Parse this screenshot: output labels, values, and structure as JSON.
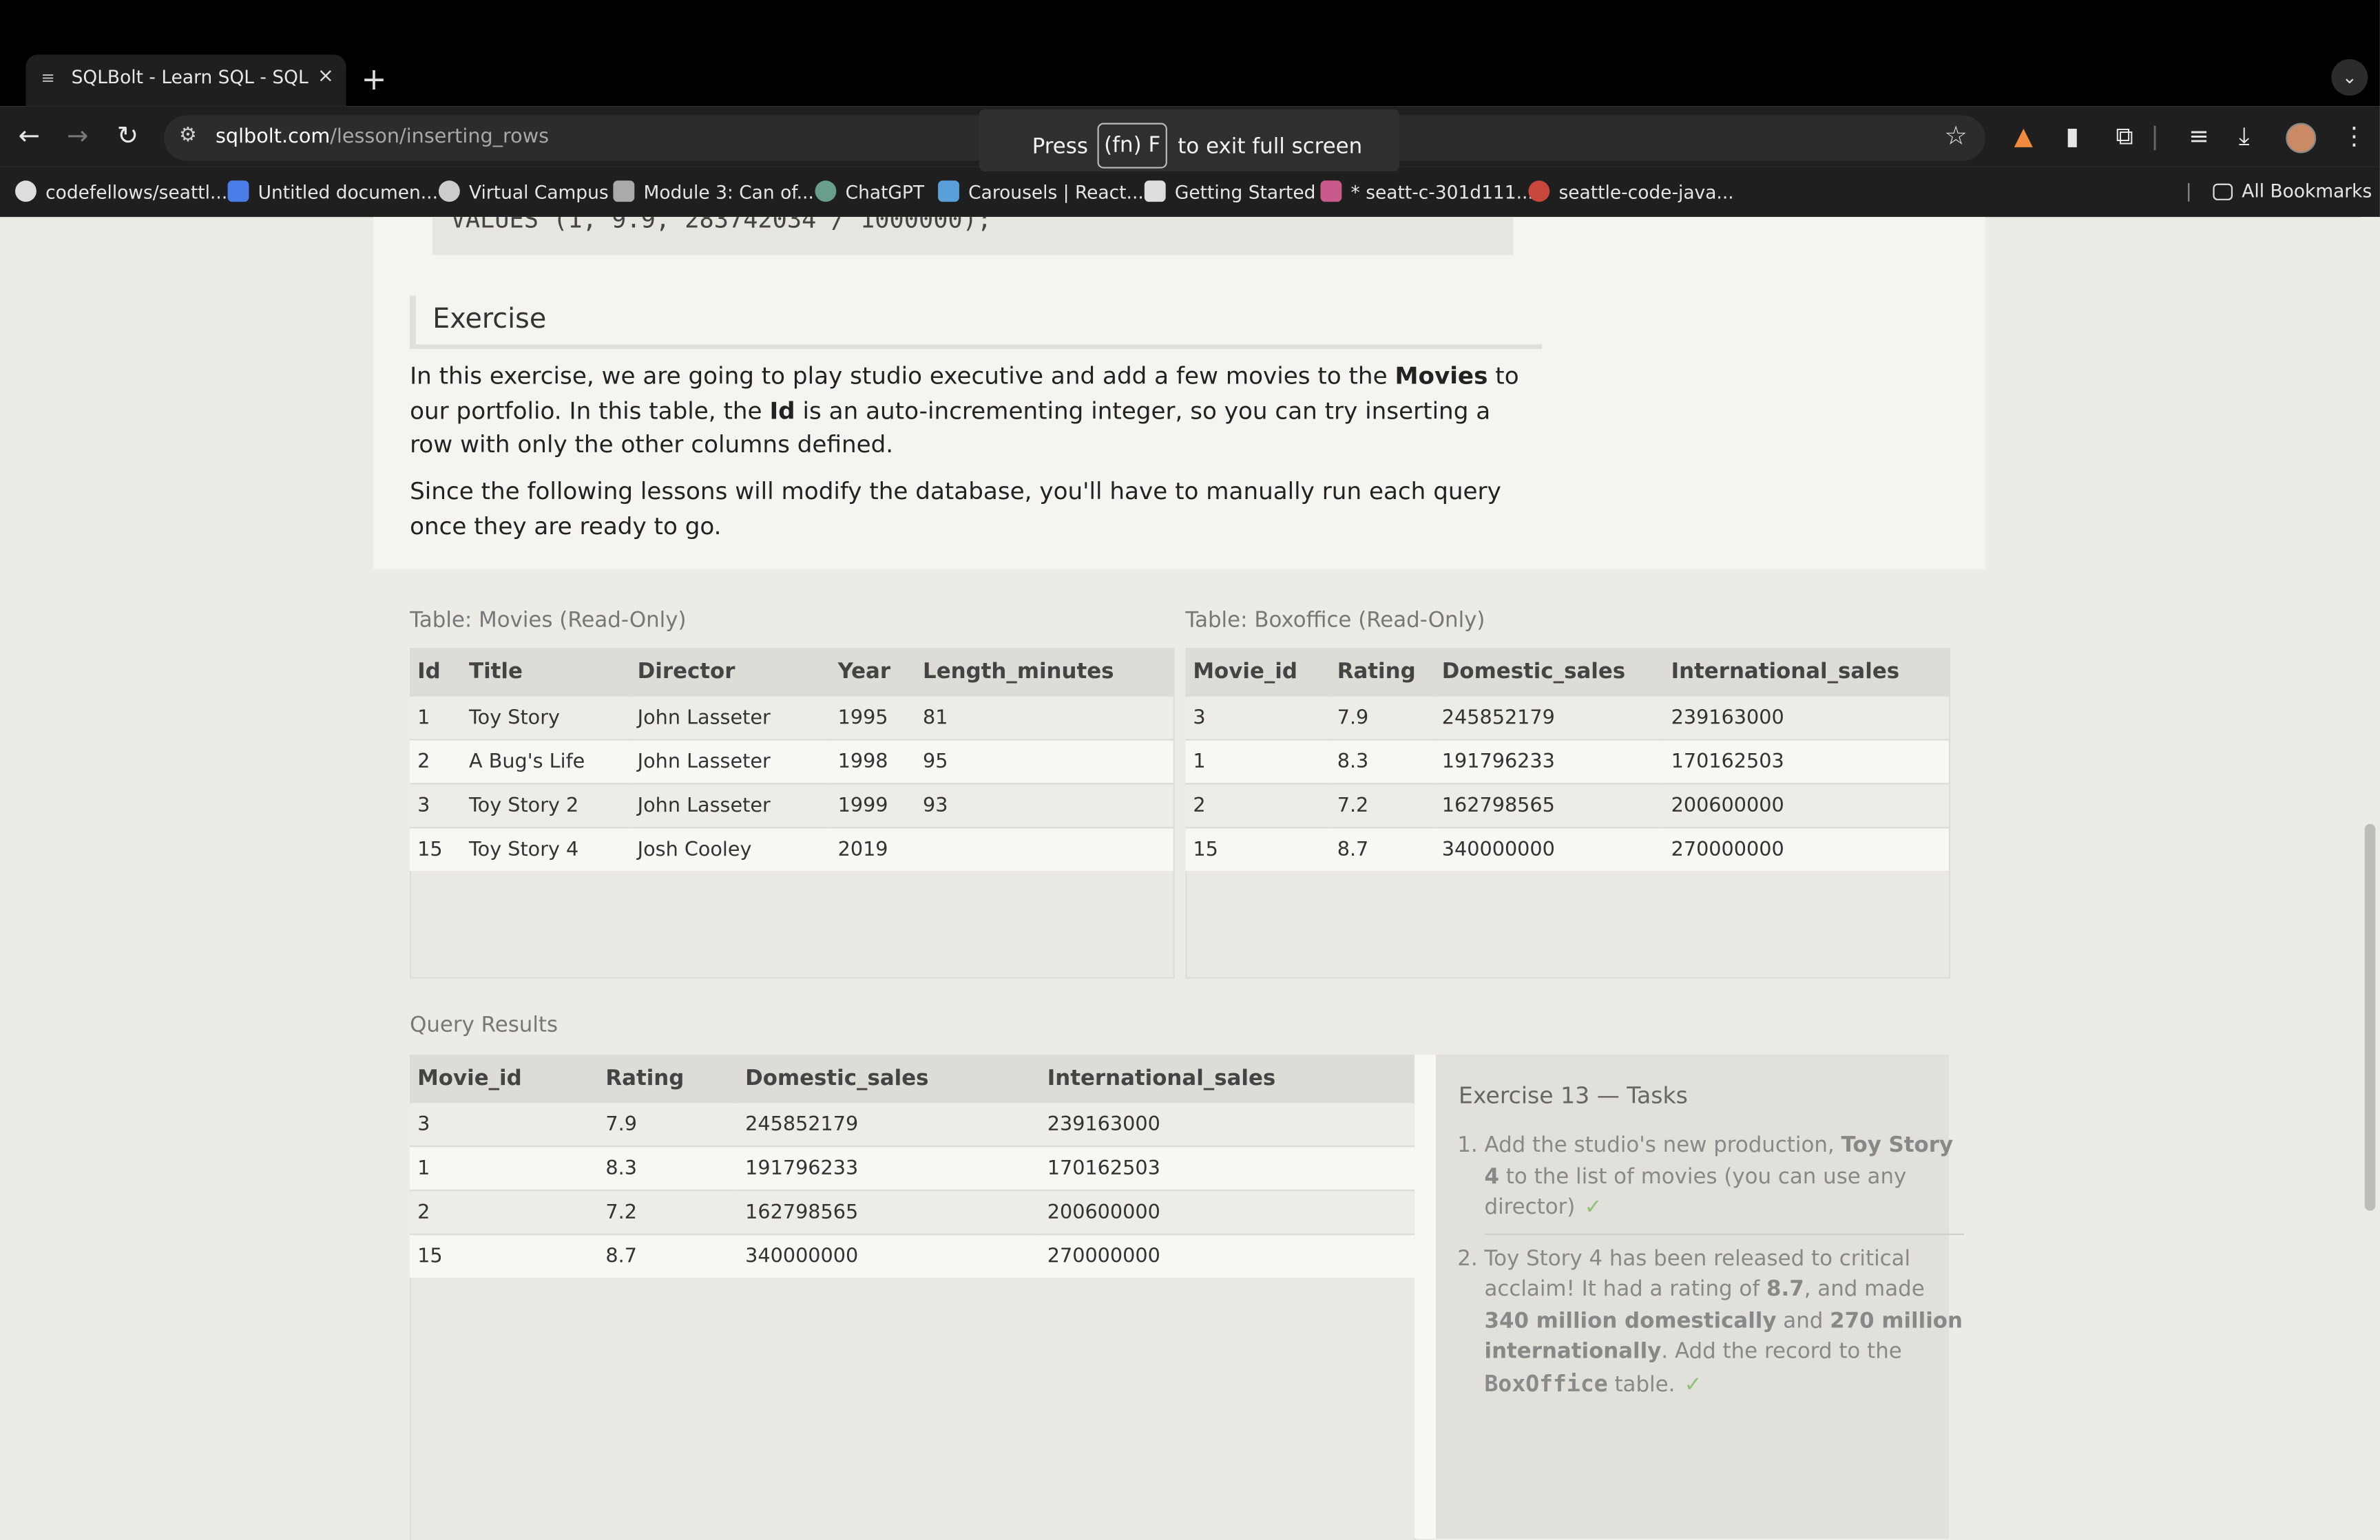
{
  "browser": {
    "tab_title": "SQLBolt - Learn SQL - SQL L",
    "tab_close": "×",
    "new_tab": "+",
    "url_host": "sqlbolt.com",
    "url_path": "/lesson/inserting_rows",
    "fullscreen_press": "Press",
    "fullscreen_key": "(fn) F",
    "fullscreen_exit": "to exit full screen",
    "bookmarks": [
      "codefellows/seattl...",
      "Untitled documen...",
      "Virtual Campus",
      "Module 3: Can of...",
      "ChatGPT",
      "Carousels | React...",
      "Getting Started",
      "* seatt-c-301d111...",
      "seattle-code-java..."
    ],
    "all_bookmarks": "All Bookmarks"
  },
  "lesson": {
    "code_line": "VALUES (1, 9.9, 283742034 / 1000000);",
    "exercise_heading": "Exercise",
    "p1_a": "In this exercise, we are going to play studio executive and add a few movies to the ",
    "p1_movies": "Movies",
    "p1_b": " to our portfolio. In this table, the ",
    "p1_id": "Id",
    "p1_c": " is an auto-incrementing integer, so you can try inserting a row with only the other columns defined.",
    "p2": "Since the following lessons will modify the database, you'll have to manually run each query once they are ready to go."
  },
  "movies_table": {
    "caption": "Table: Movies (Read-Only)",
    "headers": [
      "Id",
      "Title",
      "Director",
      "Year",
      "Length_minutes"
    ],
    "rows": [
      [
        "1",
        "Toy Story",
        "John Lasseter",
        "1995",
        "81"
      ],
      [
        "2",
        "A Bug's Life",
        "John Lasseter",
        "1998",
        "95"
      ],
      [
        "3",
        "Toy Story 2",
        "John Lasseter",
        "1999",
        "93"
      ],
      [
        "15",
        "Toy Story 4",
        "Josh Cooley",
        "2019",
        ""
      ]
    ]
  },
  "boxoffice_table": {
    "caption": "Table: Boxoffice (Read-Only)",
    "headers": [
      "Movie_id",
      "Rating",
      "Domestic_sales",
      "International_sales"
    ],
    "rows": [
      [
        "3",
        "7.9",
        "245852179",
        "239163000"
      ],
      [
        "1",
        "8.3",
        "191796233",
        "170162503"
      ],
      [
        "2",
        "7.2",
        "162798565",
        "200600000"
      ],
      [
        "15",
        "8.7",
        "340000000",
        "270000000"
      ]
    ]
  },
  "results_table": {
    "caption": "Query Results",
    "headers": [
      "Movie_id",
      "Rating",
      "Domestic_sales",
      "International_sales"
    ],
    "rows": [
      [
        "3",
        "7.9",
        "245852179",
        "239163000"
      ],
      [
        "1",
        "8.3",
        "191796233",
        "170162503"
      ],
      [
        "2",
        "7.2",
        "162798565",
        "200600000"
      ],
      [
        "15",
        "8.7",
        "340000000",
        "270000000"
      ]
    ]
  },
  "tasks": {
    "heading": "Exercise 13 — Tasks",
    "t1_a": "Add the studio's new production, ",
    "t1_b": "Toy Story 4",
    "t1_c": " to the list of movies (you can use any director)",
    "t2_a": "Toy Story 4 has been released to critical acclaim! It had a rating of ",
    "t2_rating": "8.7",
    "t2_b": ", and made ",
    "t2_dom": "340 million domestically",
    "t2_c": " and ",
    "t2_intl": "270 million internationally",
    "t2_d": ". Add the record to the ",
    "t2_table": "BoxOffice",
    "t2_e": " table.",
    "check": "✓"
  },
  "icons": {
    "back": "←",
    "forward": "→",
    "reload": "↻",
    "site_info": "⚙",
    "star": "☆",
    "menu": "⋮"
  }
}
